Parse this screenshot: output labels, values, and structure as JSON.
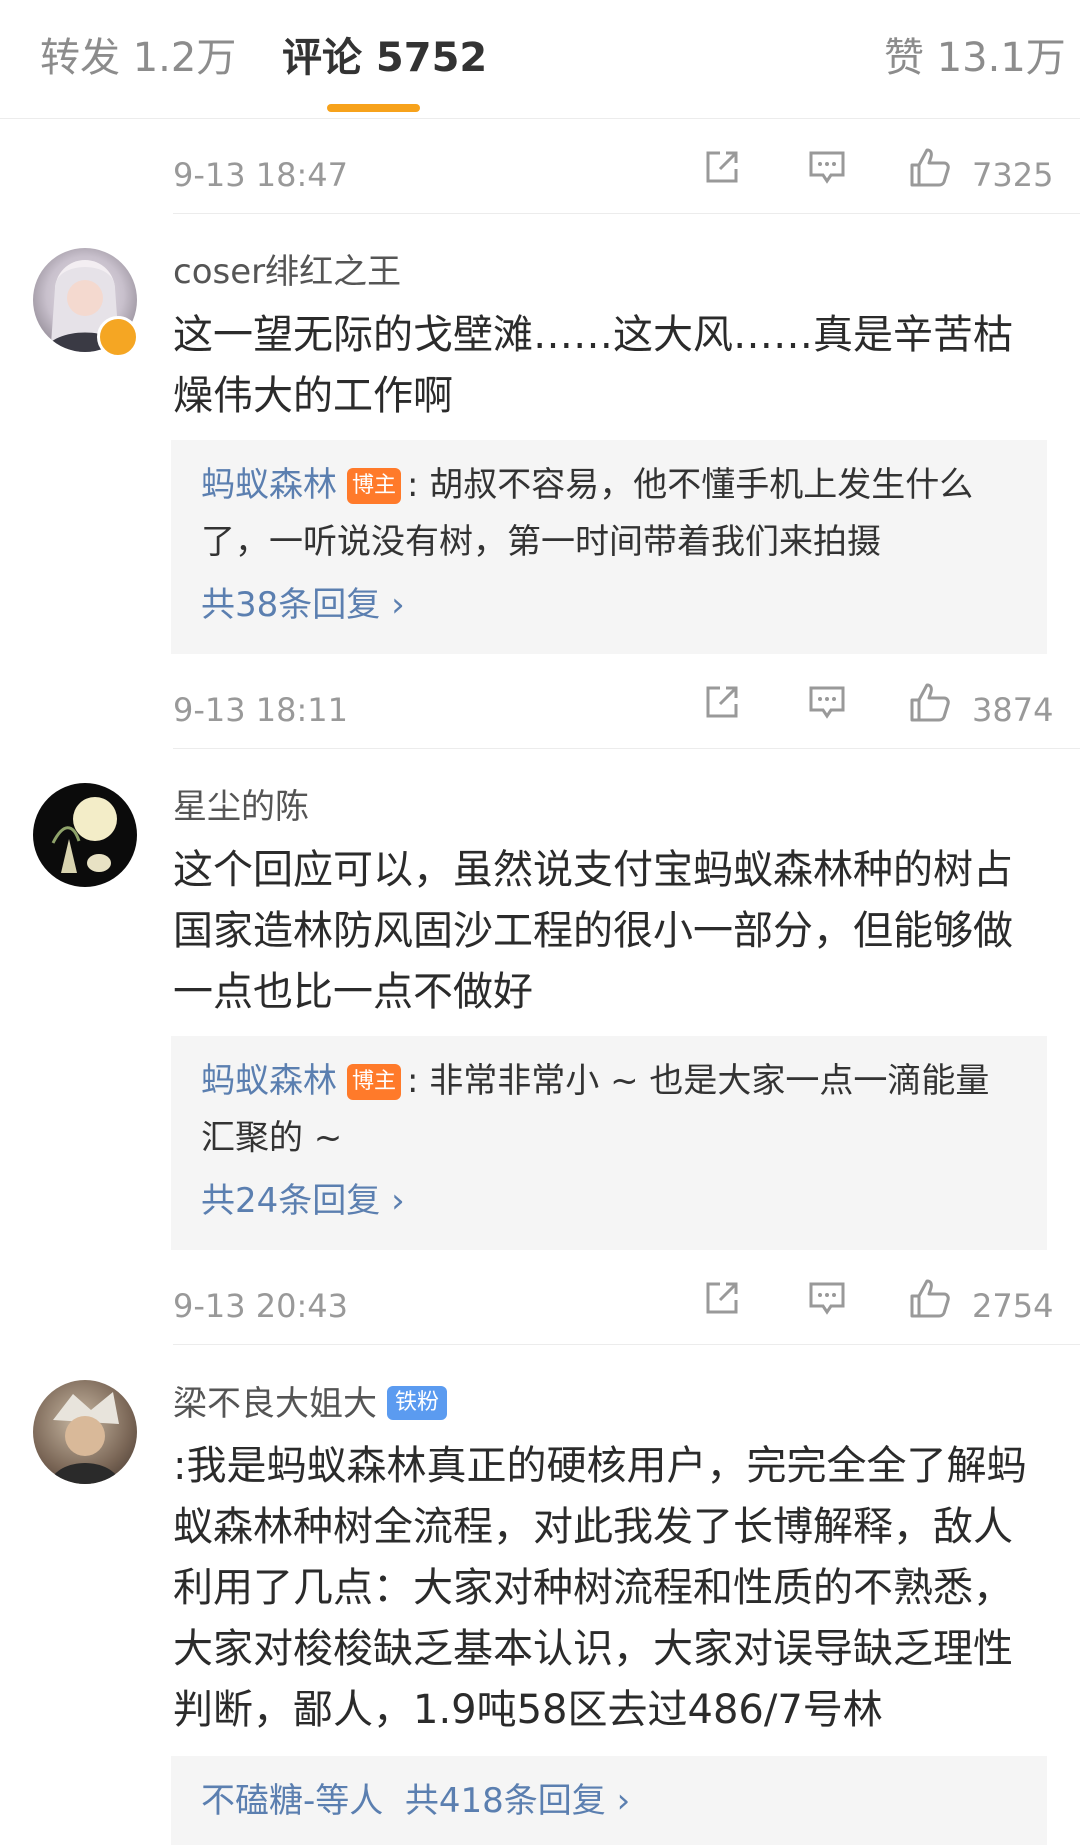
{
  "tabs": {
    "repost": "转发 1.2万",
    "comments": "评论 5752",
    "likes": "赞 13.1万"
  },
  "colors": {
    "accent": "#f7a21b",
    "link": "#5b7fb0",
    "host_badge": "#ff7a2a",
    "fan_badge": "#5b9bf0"
  },
  "icons": {
    "share": "share-icon",
    "comment": "comment-icon",
    "like": "thumbs-up-icon",
    "chevron": "chevron-right-icon"
  },
  "row0": {
    "time": "9-13 18:47",
    "likes": "7325"
  },
  "c1": {
    "user": "coser绯红之王",
    "text1": "这一望无际的戈壁滩……这大风……真是辛苦枯",
    "text2": "燥伟大的工作啊",
    "reply_author": "蚂蚁森林",
    "host_badge": "博主",
    "reply_text1": ": 胡叔不容易，他不懂手机上发生什么",
    "reply_text2": "了，一听说没有树，第一时间带着我们来拍摄",
    "more": "共38条回复 ›",
    "time": "9-13 18:11",
    "likes": "3874"
  },
  "c2": {
    "user": "星尘的陈",
    "text1": "这个回应可以，虽然说支付宝蚂蚁森林种的树占",
    "text2": "国家造林防风固沙工程的很小一部分，但能够做",
    "text3": "一点也比一点不做好",
    "reply_author": "蚂蚁森林",
    "host_badge": "博主",
    "reply_text1": ": 非常非常小 ~ 也是大家一点一滴能量",
    "reply_text2": "汇聚的 ~",
    "more": "共24条回复 ›",
    "time": "9-13 20:43",
    "likes": "2754"
  },
  "c3": {
    "user": "梁不良大姐大",
    "fan_badge": "铁粉",
    "text1": ":我是蚂蚁森林真正的硬核用户，完完全全了解蚂",
    "text2": "蚁森林种树全流程，对此我发了长博解释，敌人",
    "text3": "利用了几点：大家对种树流程和性质的不熟悉，",
    "text4": "大家对梭梭缺乏基本认识，大家对误导缺乏理性",
    "text5": "判断，鄙人，1.9吨58区去过486/7号林",
    "reply_author": "不磕糖-等人",
    "more": "共418条回复 ›"
  }
}
